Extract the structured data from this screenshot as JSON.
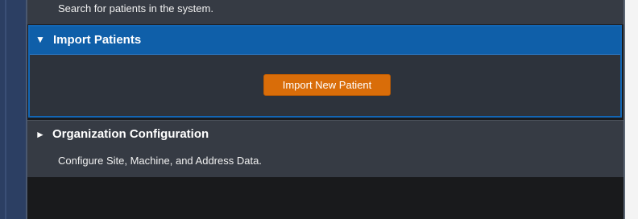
{
  "search_section": {
    "description": "Search for patients in the system."
  },
  "import_section": {
    "expanded_icon": "triangle-down-icon",
    "title": "Import Patients",
    "button_label": "Import New Patient"
  },
  "org_section": {
    "collapsed_icon": "triangle-right-icon",
    "title": "Organization Configuration",
    "description": "Configure Site, Machine, and Address Data."
  },
  "colors": {
    "accent_blue": "#0f5fa9",
    "button_orange": "#d96d09",
    "panel_bg": "#363b44",
    "dark_bg": "#191a1c"
  }
}
